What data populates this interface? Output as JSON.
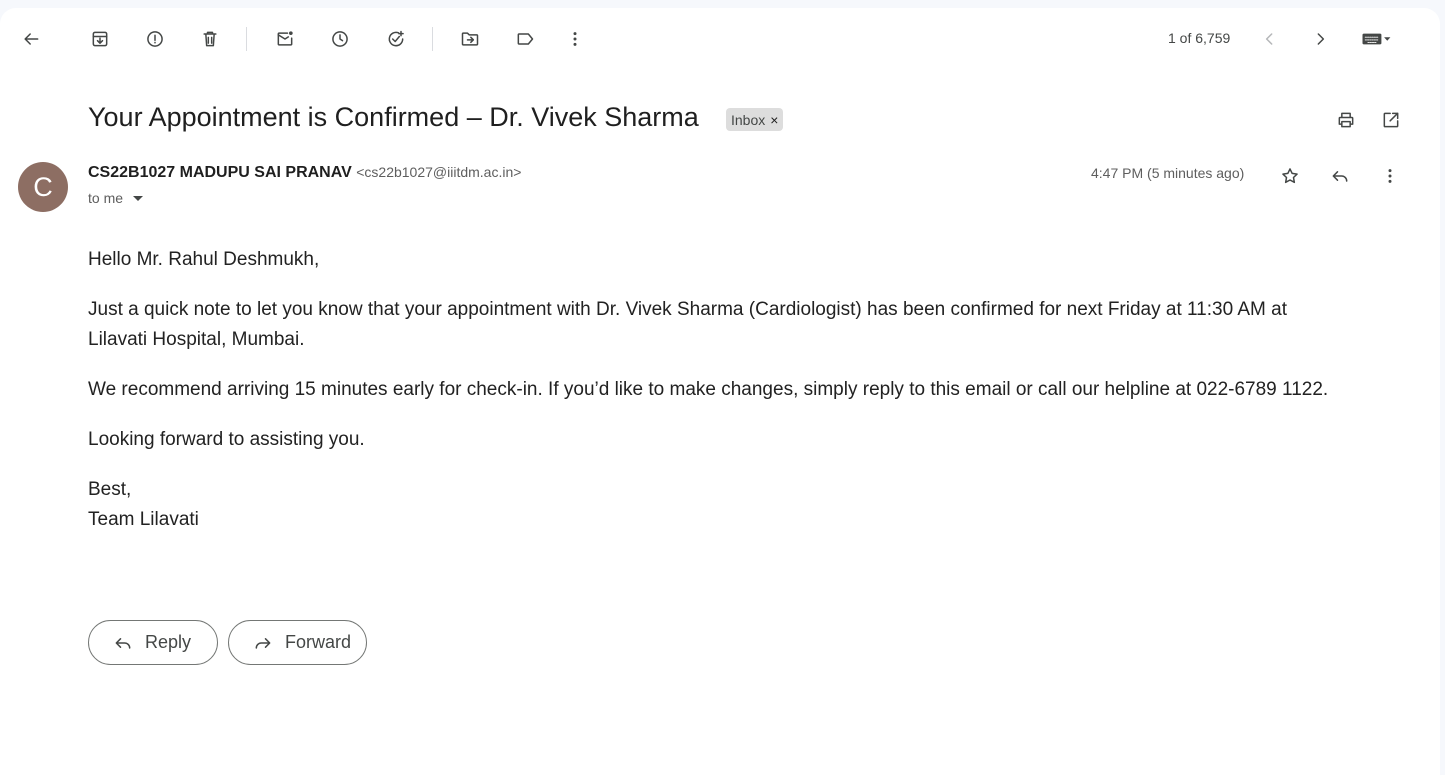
{
  "toolbar": {
    "icons": [
      "back-arrow-icon",
      "archive-icon",
      "report-spam-icon",
      "delete-icon",
      "mark-unread-icon",
      "snooze-icon",
      "add-to-tasks-icon",
      "move-to-icon",
      "labels-icon",
      "more-vert-icon"
    ],
    "counter": "1 of 6,759"
  },
  "message": {
    "subject": "Your Appointment is Confirmed – Dr. Vivek Sharma",
    "label": "Inbox",
    "label_close": "×",
    "avatar_letter": "C",
    "avatar_color": "#8d6e63",
    "sender_name": "CS22B1027 MADUPU SAI PRANAV",
    "sender_email": "<cs22b1027@iiitdm.ac.in>",
    "recipient": "to me",
    "timestamp": "4:47 PM (5 minutes ago)",
    "body": {
      "greeting": "Hello Mr. Rahul Deshmukh,",
      "paragraph1": "Just a quick note to let you know that your appointment with Dr. Vivek Sharma (Cardiologist) has been confirmed for next Friday at 11:30 AM at Lilavati Hospital, Mumbai.",
      "paragraph2": "We recommend arriving 15 minutes early for check-in. If you’d like to make changes, simply reply to this email or call our helpline at 022-6789 1122.",
      "paragraph3": "Looking forward to assisting you.",
      "signoff": "Best,",
      "signature": "Team Lilavati"
    }
  },
  "actions": {
    "reply_label": "Reply",
    "forward_label": "Forward"
  }
}
